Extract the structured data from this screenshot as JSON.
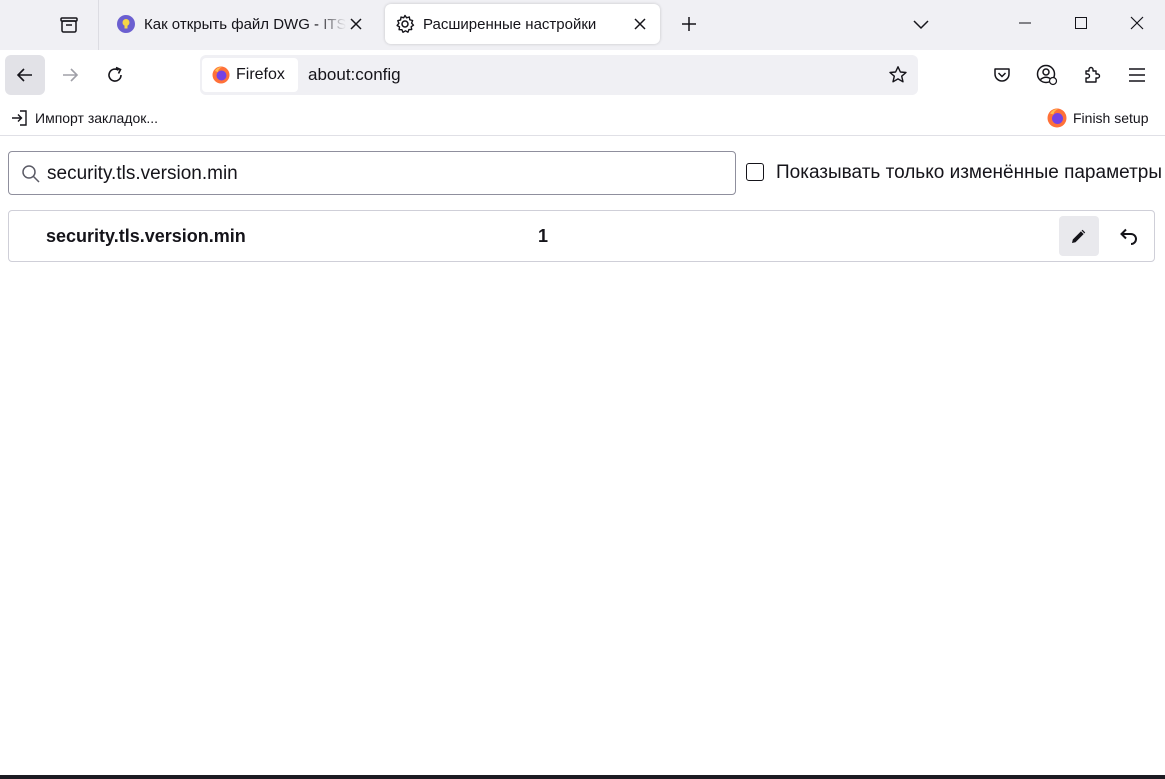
{
  "tabs": [
    {
      "title": "Как открыть файл DWG - ITSer",
      "favicon": "lightbulb-favicon",
      "active": false
    },
    {
      "title": "Расширенные настройки",
      "favicon": "gear-icon",
      "active": true
    }
  ],
  "urlbar": {
    "identity_label": "Firefox",
    "url": "about:config"
  },
  "bookmarks": {
    "import_label": "Импорт закладок...",
    "finish_setup_label": "Finish setup"
  },
  "config": {
    "search_value": "security.tls.version.min",
    "modified_only_label": "Показывать только изменённые параметры",
    "modified_only_checked": false,
    "preferences": [
      {
        "name": "security.tls.version.min",
        "value": "1"
      }
    ]
  },
  "colors": {
    "titlebar": "#f0f0f4",
    "urlbar_bg": "#f0f0f4",
    "text": "#15141a",
    "favicon_purple": "#6b5fd0",
    "firefox_orange": "#ff7139"
  }
}
